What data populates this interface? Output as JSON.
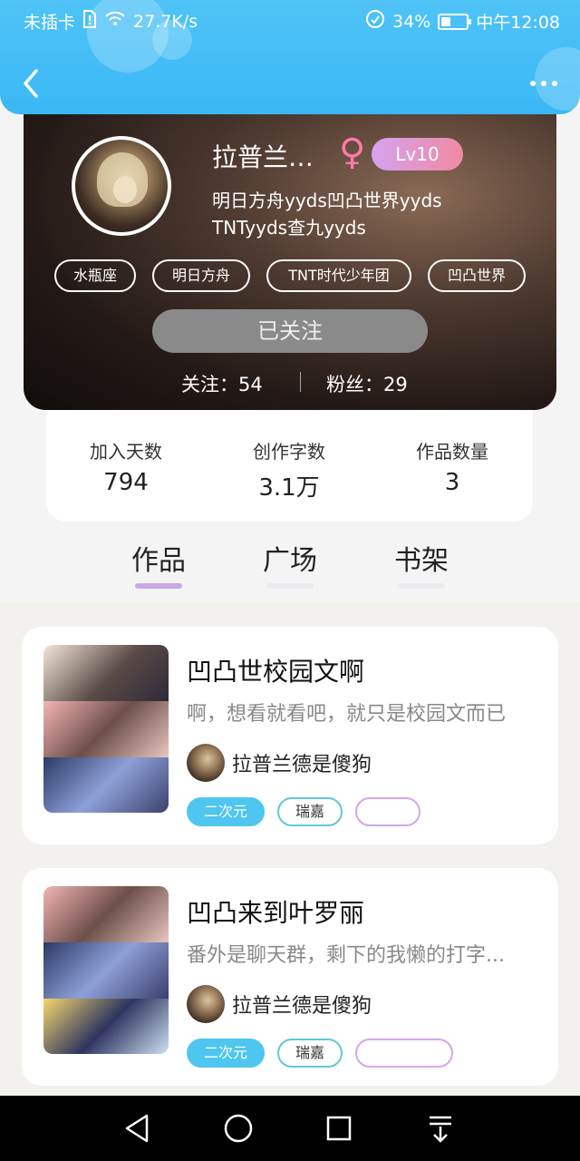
{
  "status_bar": {
    "carrier": "未插卡",
    "net_speed": "27.7K/s",
    "battery": "34%",
    "time": "中午12:08"
  },
  "profile": {
    "username": "拉普兰…",
    "gender_symbol": "♀",
    "level": "Lv10",
    "bio_line1": "明日方舟yyds凹凸世界yyds",
    "bio_line2": "TNTyyds查九yyds",
    "tags": [
      "水瓶座",
      "明日方舟",
      "TNT时代少年团",
      "凹凸世界"
    ],
    "follow_button": "已关注",
    "following": "关注：54",
    "followers": "粉丝：29"
  },
  "stats": [
    {
      "label": "加入天数",
      "value": "794"
    },
    {
      "label": "创作字数",
      "value": "3.1万"
    },
    {
      "label": "作品数量",
      "value": "3"
    }
  ],
  "tabs": [
    {
      "label": "作品",
      "active": true
    },
    {
      "label": "广场",
      "active": false
    },
    {
      "label": "书架",
      "active": false
    }
  ],
  "works": [
    {
      "title": "凹凸世校园文啊",
      "description": "啊，想看就看吧，就只是校园文而已",
      "author": "拉普兰德是傻狗",
      "tags": [
        "二次元",
        "瑞嘉",
        ""
      ]
    },
    {
      "title": "凹凸来到叶罗丽",
      "description": "番外是聊天群，剩下的我懒的打字...",
      "author": "拉普兰德是傻狗",
      "tags": [
        "二次元",
        "瑞嘉",
        ""
      ]
    }
  ],
  "colors": {
    "header_blue": "#3ab8f5",
    "level_gradient_start": "#d6a2ef",
    "level_gradient_end": "#f08aa2",
    "tag_solid": "#4ec6ef",
    "tab_indicator": "#c9a8e6"
  }
}
